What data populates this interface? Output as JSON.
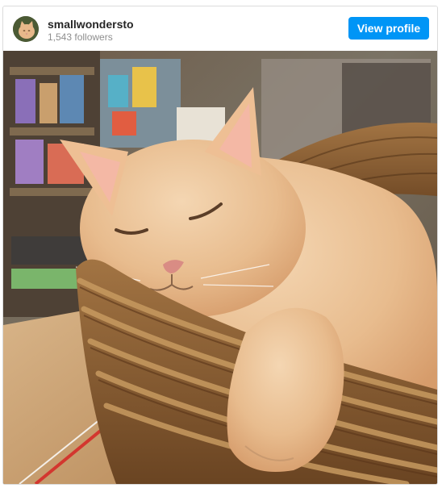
{
  "post": {
    "username": "smallwondersto",
    "followers": "1,543 followers",
    "view_profile_label": "View profile",
    "accent_color": "#0095f6"
  },
  "media": {
    "subject": "orange cat sleeping in wicker basket",
    "icons": [
      "avatar-icon"
    ]
  }
}
